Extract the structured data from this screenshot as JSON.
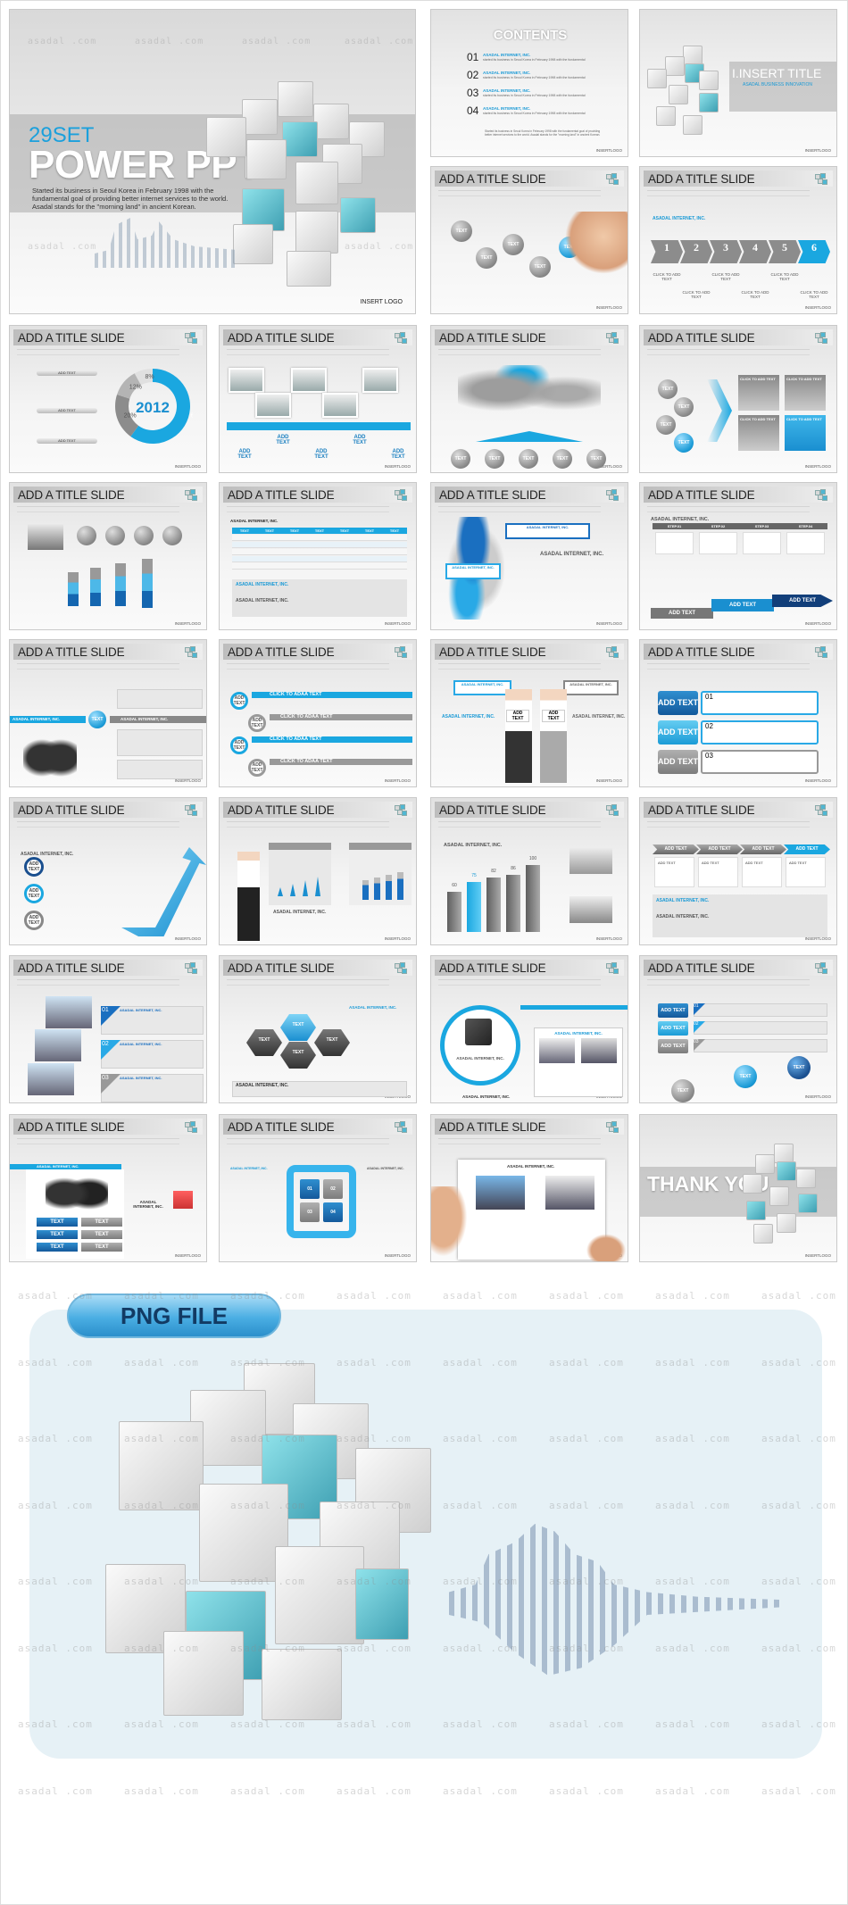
{
  "watermark": "asadal .com",
  "cover": {
    "set_label": "29SET",
    "title": "POWER PPT",
    "body": "Started its business in Seoul Korea in February 1998 with the fundamental goal of providing better internet services to the world. Asadal stands for the \"morning land\" in ancient Korean.",
    "logo": "INSERT LOGO"
  },
  "contents": {
    "title": "CONTENTS",
    "items": [
      {
        "num": "01",
        "head": "ASADAL INTERNET, INC.",
        "text": "started its business in Seoul Korea in February 1998 with the fundamental"
      },
      {
        "num": "02",
        "head": "ASADAL INTERNET, INC.",
        "text": "started its business in Seoul Korea in February 1998 with the fundamental"
      },
      {
        "num": "03",
        "head": "ASADAL INTERNET, INC.",
        "text": "started its business in Seoul Korea in February 1998 with the fundamental"
      },
      {
        "num": "04",
        "head": "ASADAL INTERNET, INC.",
        "text": "started its business in Seoul Korea in February 1998 with the fundamental"
      }
    ],
    "footer": "Started its business in Seoul Korea in February 1998 with the fundamental goal of providing better internet services to the world. Asadal stands for the \"morning land\" in ancient Korean.",
    "logo": "INSERTLOGO"
  },
  "section": {
    "title": "I.INSERT TITLE",
    "subtitle": "ASADAL BUSINESS INNOVATION",
    "logo": "INSERTLOGO"
  },
  "slide_title": "ADD A TITLE SLIDE",
  "insert_logo": "INSERTLOGO",
  "company": "ASADAL INTERNET, INC.",
  "text_label": "TEXT",
  "add_text": "ADD TEXT",
  "add_text_2line": "ADD\nTEXT",
  "click_to_add": "CLICK TO ADD TEXT",
  "click_adaa": "CLICK TO ADAA TEXT",
  "steps": [
    "1",
    "2",
    "3",
    "4",
    "5",
    "6"
  ],
  "step_labels": [
    "STEP.01",
    "STEP.02",
    "STEP.03",
    "STEP.04"
  ],
  "donut": {
    "center": "2012",
    "slices": [
      {
        "label": "60%",
        "value": 60,
        "color": "#1aa7e0"
      },
      {
        "label": "20%",
        "value": 20,
        "color": "#8c8c8c"
      },
      {
        "label": "12%",
        "value": 12,
        "color": "#b4b4b4"
      },
      {
        "label": "8%",
        "value": 8,
        "color": "#e0e0e0"
      }
    ]
  },
  "bar_values": [
    "60",
    "75",
    "82",
    "86",
    "100"
  ],
  "numbered": [
    "01",
    "02",
    "03",
    "04"
  ],
  "thank_you": {
    "title": "THANK YOU",
    "logo": "INSERTLOGO"
  },
  "png": {
    "label": "PNG FILE"
  }
}
